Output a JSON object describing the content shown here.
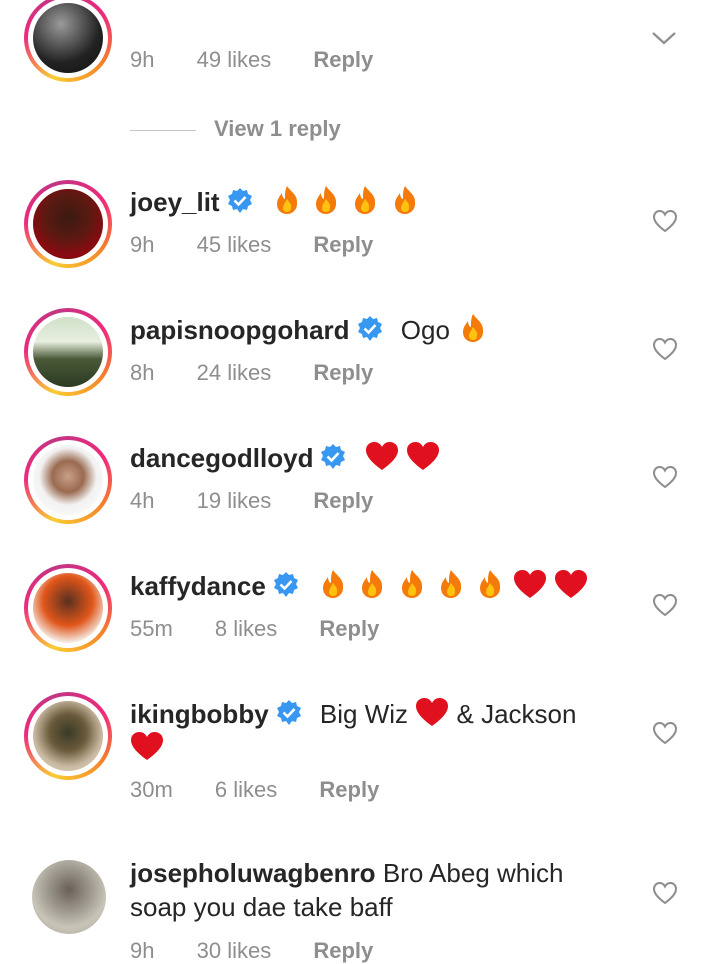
{
  "comments": [
    {
      "time": "9h",
      "likes": "49 likes",
      "reply": "Reply"
    },
    {
      "username": "joey_lit",
      "text": "",
      "time": "9h",
      "likes": "45 likes",
      "reply": "Reply",
      "emojis": [
        "fire",
        "fire",
        "fire",
        "fire"
      ]
    },
    {
      "username": "papisnoopgohard",
      "text": "Ogo",
      "time": "8h",
      "likes": "24 likes",
      "reply": "Reply",
      "emojis": [
        "fire"
      ]
    },
    {
      "username": "dancegodlloyd",
      "text": "",
      "time": "4h",
      "likes": "19 likes",
      "reply": "Reply",
      "emojis": [
        "red-heart",
        "red-heart"
      ]
    },
    {
      "username": "kaffydance",
      "text": "",
      "time": "55m",
      "likes": "8 likes",
      "reply": "Reply",
      "emojis": [
        "fire",
        "fire",
        "fire",
        "fire",
        "fire",
        "red-heart",
        "red-heart"
      ]
    },
    {
      "username": "ikingbobby",
      "text_part1": "Big Wiz",
      "text_part2": "& Jackson",
      "time": "30m",
      "likes": "6 likes",
      "reply": "Reply"
    },
    {
      "username": "josepholuwagbenro",
      "text_line1": "Bro Abeg which",
      "text_line2": "soap you dae take baff",
      "time": "9h",
      "likes": "30 likes",
      "reply": "Reply"
    }
  ],
  "view_replies": "View 1 reply",
  "colors": {
    "verified": "#3897f0",
    "meta": "#8e8e8e",
    "heart_red": "#e0101f"
  }
}
